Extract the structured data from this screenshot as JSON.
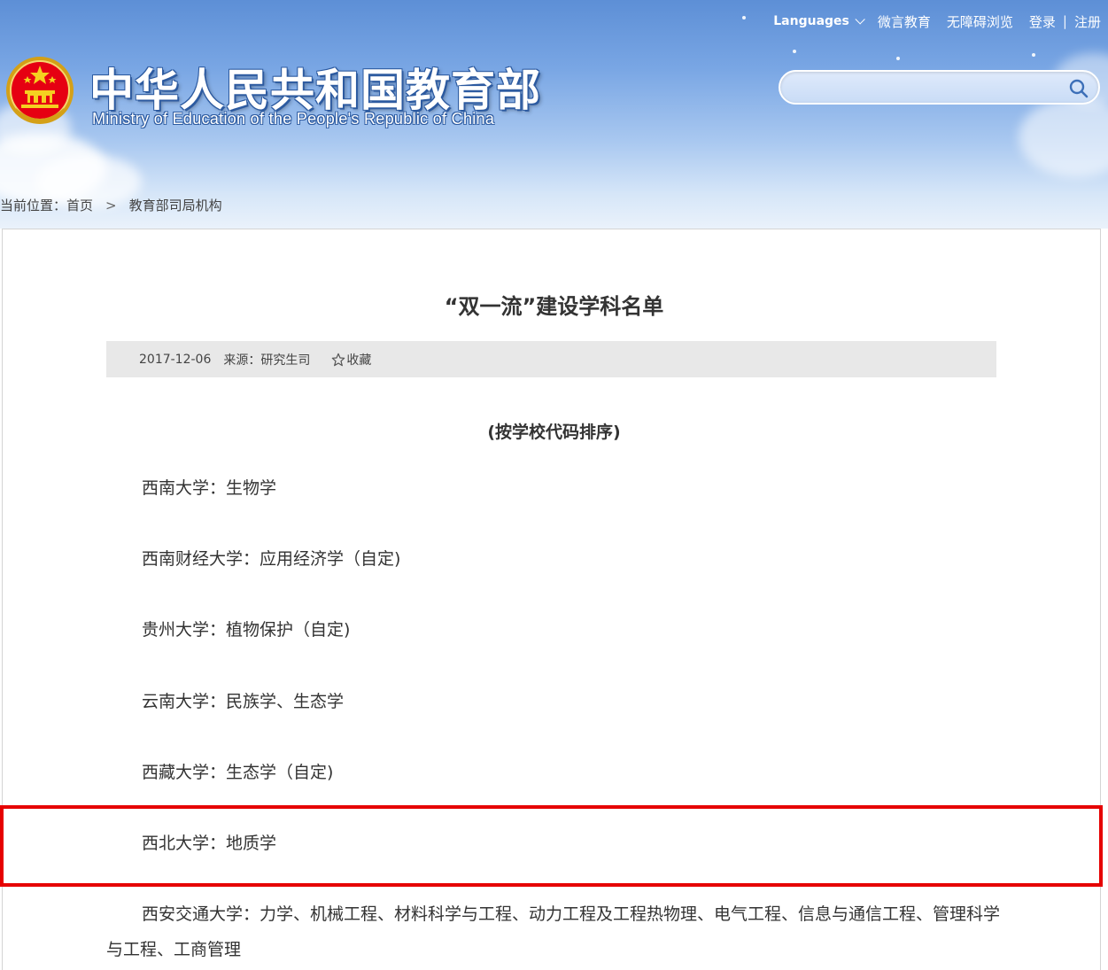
{
  "topnav": {
    "languages": "Languages",
    "items": [
      "微言教育",
      "无障碍浏览",
      "登录"
    ],
    "separator": "|",
    "register": "注册"
  },
  "header": {
    "title_cn": "中华人民共和国教育部",
    "title_en": "Ministry of Education of the People's Republic of China"
  },
  "search": {
    "value": "",
    "placeholder": ""
  },
  "breadcrumb": {
    "label": "当前位置：",
    "home": "首页",
    "separator": ">",
    "current": "教育部司局机构"
  },
  "article": {
    "title": "“双一流”建设学科名单",
    "date": "2017-12-06",
    "source": "来源：研究生司",
    "favorite": "收藏",
    "subtitle": "(按学校代码排序)",
    "entries": [
      "西南大学：生物学",
      "西南财经大学：应用经济学（自定)",
      "贵州大学：植物保护（自定)",
      "云南大学：民族学、生态学",
      "西藏大学：生态学（自定)",
      "西北大学：地质学",
      "西安交通大学：力学、机械工程、材料科学与工程、动力工程及工程热物理、电气工程、信息与通信工程、管理科学与工程、工商管理"
    ]
  },
  "colors": {
    "header_top": "#5d8fd6",
    "header_bottom": "#eaf2fb",
    "meta_bar": "#e8e8e8",
    "highlight_border": "#e60000"
  },
  "icons": {
    "search": "magnifier-icon",
    "favorite": "star-outline-icon",
    "languages_dropdown": "chevron-down-icon",
    "emblem": "national-emblem-icon"
  }
}
